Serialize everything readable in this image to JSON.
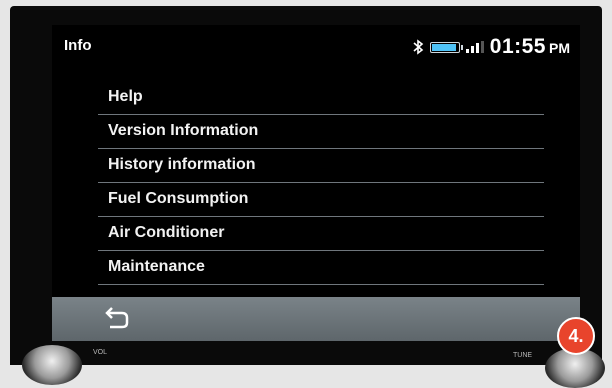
{
  "header": {
    "title": "Info"
  },
  "status": {
    "bluetooth_icon": "bluetooth-icon",
    "battery_level": 0.85,
    "signal_bars": 3,
    "signal_icon": "signal-bars-icon",
    "battery_icon": "battery-icon",
    "battery_color": "#4fc3f7"
  },
  "clock": {
    "time": "01:55",
    "ampm": "PM"
  },
  "menu": {
    "items": [
      {
        "label": "Help"
      },
      {
        "label": "Version Information"
      },
      {
        "label": "History information"
      },
      {
        "label": "Fuel Consumption"
      },
      {
        "label": "Air Conditioner"
      },
      {
        "label": "Maintenance"
      }
    ]
  },
  "bottom_bar": {
    "back_icon": "back-arrow-icon"
  },
  "hardware": {
    "vol_label": "VOL",
    "tune_label": "TUNE"
  },
  "badge": {
    "label": "4."
  }
}
